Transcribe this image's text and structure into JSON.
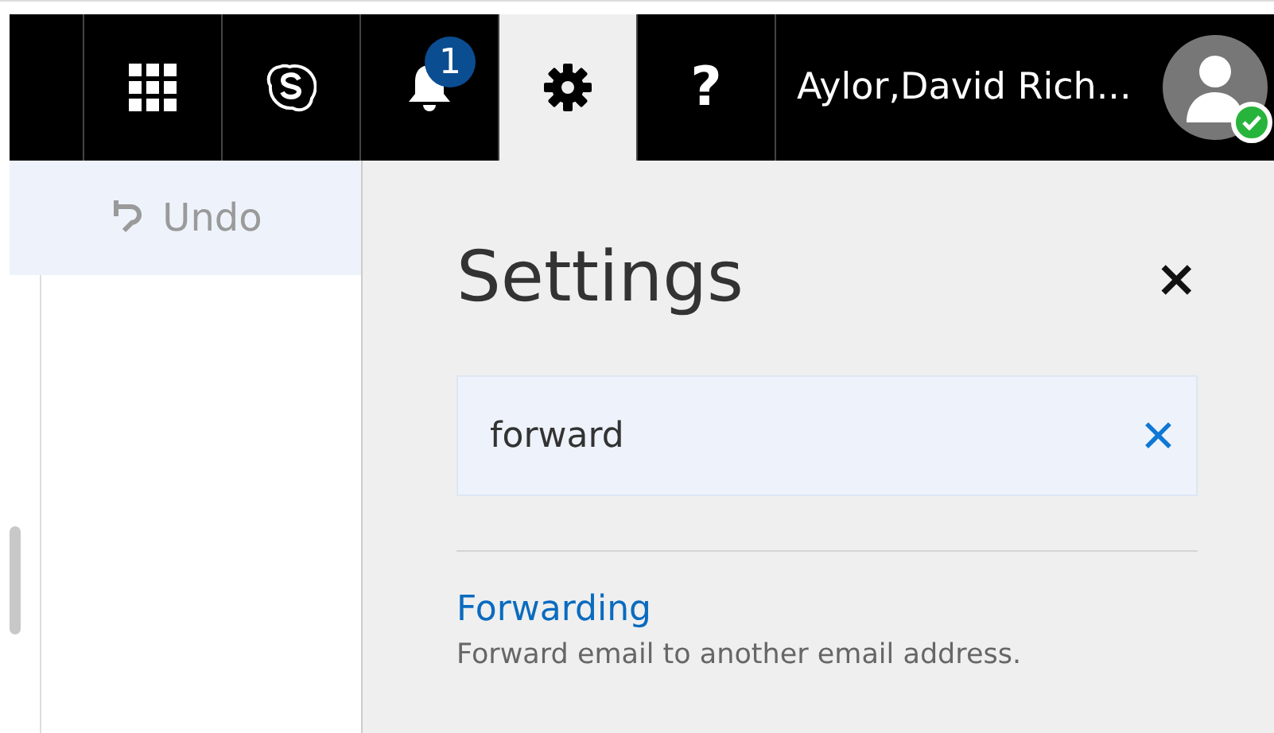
{
  "top_bar": {
    "items": [
      {
        "kind": "apps",
        "selected": false
      },
      {
        "kind": "skype",
        "selected": false
      },
      {
        "kind": "notifications",
        "badge": "1",
        "selected": false
      },
      {
        "kind": "settings",
        "selected": true
      },
      {
        "kind": "help",
        "label": "?",
        "selected": false
      }
    ],
    "user": {
      "name": "Aylor,David Rich...",
      "online": true
    }
  },
  "toolbar": {
    "undo": {
      "label": "Undo",
      "disabled": true
    }
  },
  "settings_panel": {
    "title": "Settings",
    "close": "×",
    "search": {
      "value": "forward",
      "clear": "✕"
    },
    "results": [
      {
        "title": "Forwarding",
        "description": "Forward email to another email address."
      }
    ]
  }
}
